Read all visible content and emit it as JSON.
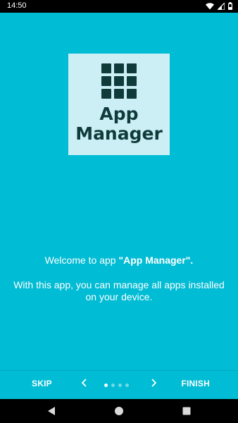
{
  "status_bar": {
    "time": "14:50",
    "icons": [
      "wifi-icon",
      "signal-icon",
      "battery-icon"
    ]
  },
  "logo": {
    "line1": "App",
    "line2": "Manager",
    "icon": "grid-icon"
  },
  "intro": {
    "welcome_prefix": "Welcome to app ",
    "app_name": "\"App Manager\".",
    "description": "With this app, you can manage all apps installed on your device."
  },
  "navigation": {
    "skip_label": "SKIP",
    "finish_label": "FINISH",
    "page_count": 4,
    "current_page": 1
  },
  "system_nav": [
    "back-icon",
    "home-icon",
    "recents-icon"
  ],
  "colors": {
    "background": "#00BCD4",
    "logo_bg": "#CCEFF5",
    "logo_fg": "#0F3B3B"
  }
}
